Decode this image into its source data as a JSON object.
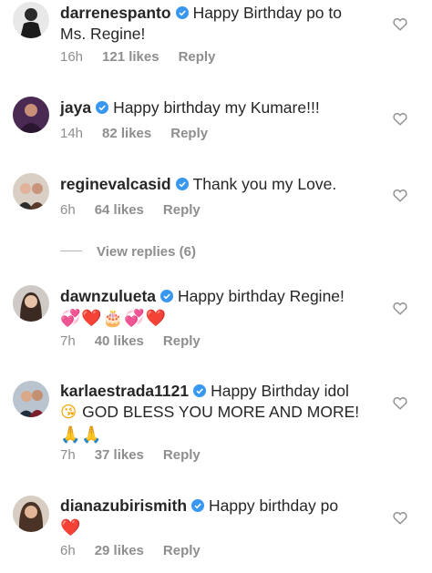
{
  "comments": [
    {
      "username": "darrenespanto",
      "text_line1": "Happy Birthday po to",
      "text_line2": "Ms. Regine!",
      "time": "16h",
      "likes": "121 likes",
      "reply": "Reply"
    },
    {
      "username": "jaya",
      "text_line1": "Happy birthday my Kumare!!!",
      "time": "14h",
      "likes": "82 likes",
      "reply": "Reply"
    },
    {
      "username": "reginevalcasid",
      "text_line1": "Thank you my Love.",
      "time": "6h",
      "likes": "64 likes",
      "reply": "Reply",
      "view_replies": "View replies (6)"
    },
    {
      "username": "dawnzulueta",
      "text_line1": "Happy birthday Regine!",
      "emojis": [
        "💞",
        "❤️",
        "🎂",
        "💞",
        "❤️"
      ],
      "time": "7h",
      "likes": "40 likes",
      "reply": "Reply"
    },
    {
      "username": "karlaestrada1121",
      "text_line1": "Happy Birthday idol",
      "text_line2": "GOD BLESS YOU MORE AND MORE!",
      "emoji_line2_prefix": "😘",
      "emojis": [
        "🙏",
        "🙏"
      ],
      "time": "7h",
      "likes": "37 likes",
      "reply": "Reply"
    },
    {
      "username": "dianazubirismith",
      "text_line1": "Happy birthday po",
      "emojis": [
        "❤️"
      ],
      "time": "6h",
      "likes": "29 likes",
      "reply": "Reply"
    }
  ],
  "icons": {
    "verified": "verified-badge-icon",
    "like": "heart-outline-icon"
  },
  "colors": {
    "text": "#262626",
    "meta": "#8e8e8e",
    "verified": "#3897f0"
  }
}
